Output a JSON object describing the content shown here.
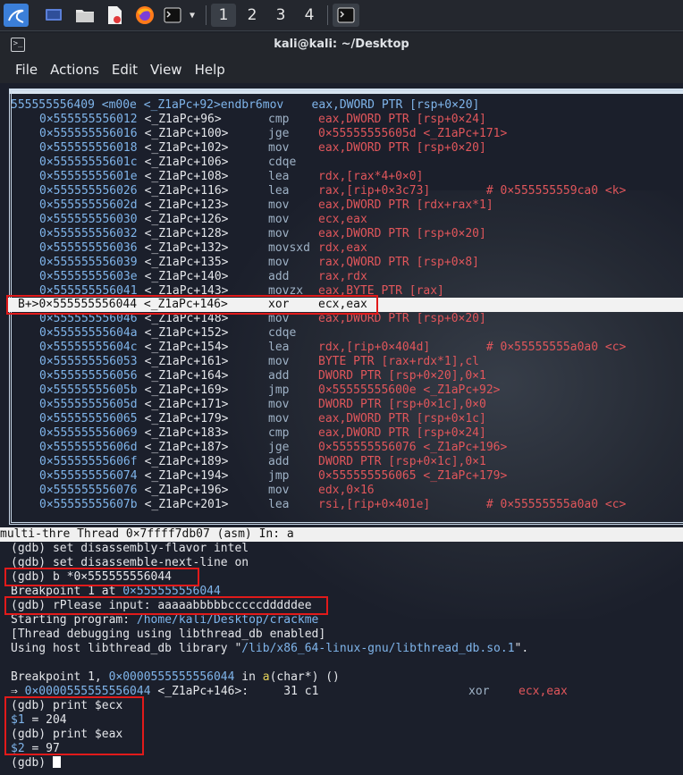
{
  "taskbar": {
    "workspaces": [
      "1",
      "2",
      "3",
      "4"
    ],
    "icons": [
      "kali-logo-icon",
      "workspace-icon",
      "files-icon",
      "editor-icon",
      "firefox-icon",
      "terminal-icon",
      "chevron-down-icon"
    ]
  },
  "window": {
    "title": "kali@kali: ~/Desktop",
    "menu": [
      "File",
      "Actions",
      "Edit",
      "View",
      "Help"
    ]
  },
  "asm": {
    "first_line": "555555556409 <m00e <_Z1aPc+92>endbr6mov    eax,DWORD PTR [rsp+0×20]",
    "rows": [
      {
        "addr": "0×555555556012",
        "sym": "<_Z1aPc+96>",
        "op": "cmp",
        "args": "eax,DWORD PTR [rsp+0×24]"
      },
      {
        "addr": "0×555555556016",
        "sym": "<_Z1aPc+100>",
        "op": "jge",
        "args": "0×55555555605d <_Z1aPc+171>"
      },
      {
        "addr": "0×555555556018",
        "sym": "<_Z1aPc+102>",
        "op": "mov",
        "args": "eax,DWORD PTR [rsp+0×20]"
      },
      {
        "addr": "0×55555555601c",
        "sym": "<_Z1aPc+106>",
        "op": "cdqe",
        "args": ""
      },
      {
        "addr": "0×55555555601e",
        "sym": "<_Z1aPc+108>",
        "op": "lea",
        "args": "rdx,[rax*4+0×0]"
      },
      {
        "addr": "0×555555556026",
        "sym": "<_Z1aPc+116>",
        "op": "lea",
        "args": "rax,[rip+0×3c73]        # 0×555555559ca0 <k>"
      },
      {
        "addr": "0×55555555602d",
        "sym": "<_Z1aPc+123>",
        "op": "mov",
        "args": "eax,DWORD PTR [rdx+rax*1]"
      },
      {
        "addr": "0×555555556030",
        "sym": "<_Z1aPc+126>",
        "op": "mov",
        "args": "ecx,eax"
      },
      {
        "addr": "0×555555556032",
        "sym": "<_Z1aPc+128>",
        "op": "mov",
        "args": "eax,DWORD PTR [rsp+0×20]"
      },
      {
        "addr": "0×555555556036",
        "sym": "<_Z1aPc+132>",
        "op": "movsxd",
        "args": "rdx,eax"
      },
      {
        "addr": "0×555555556039",
        "sym": "<_Z1aPc+135>",
        "op": "mov",
        "args": "rax,QWORD PTR [rsp+0×8]"
      },
      {
        "addr": "0×55555555603e",
        "sym": "<_Z1aPc+140>",
        "op": "add",
        "args": "rax,rdx"
      },
      {
        "addr": "0×555555556041",
        "sym": "<_Z1aPc+143>",
        "op": "movzx",
        "args": "eax,BYTE PTR [rax]"
      }
    ],
    "current": {
      "marker": "B+>",
      "addr": "0×555555556044",
      "sym": "<_Z1aPc+146>",
      "op": "xor",
      "args": "ecx,eax"
    },
    "rows_after": [
      {
        "addr": "0×555555556046",
        "sym": "<_Z1aPc+148>",
        "op": "mov",
        "args": "eax,DWORD PTR [rsp+0×20]"
      },
      {
        "addr": "0×55555555604a",
        "sym": "<_Z1aPc+152>",
        "op": "cdqe",
        "args": ""
      },
      {
        "addr": "0×55555555604c",
        "sym": "<_Z1aPc+154>",
        "op": "lea",
        "args": "rdx,[rip+0×404d]        # 0×55555555a0a0 <c>"
      },
      {
        "addr": "0×555555556053",
        "sym": "<_Z1aPc+161>",
        "op": "mov",
        "args": "BYTE PTR [rax+rdx*1],cl"
      },
      {
        "addr": "0×555555556056",
        "sym": "<_Z1aPc+164>",
        "op": "add",
        "args": "DWORD PTR [rsp+0×20],0×1"
      },
      {
        "addr": "0×55555555605b",
        "sym": "<_Z1aPc+169>",
        "op": "jmp",
        "args": "0×55555555600e <_Z1aPc+92>"
      },
      {
        "addr": "0×55555555605d",
        "sym": "<_Z1aPc+171>",
        "op": "mov",
        "args": "DWORD PTR [rsp+0×1c],0×0"
      },
      {
        "addr": "0×555555556065",
        "sym": "<_Z1aPc+179>",
        "op": "mov",
        "args": "eax,DWORD PTR [rsp+0×1c]"
      },
      {
        "addr": "0×555555556069",
        "sym": "<_Z1aPc+183>",
        "op": "cmp",
        "args": "eax,DWORD PTR [rsp+0×24]"
      },
      {
        "addr": "0×55555555606d",
        "sym": "<_Z1aPc+187>",
        "op": "jge",
        "args": "0×555555556076 <_Z1aPc+196>"
      },
      {
        "addr": "0×55555555606f",
        "sym": "<_Z1aPc+189>",
        "op": "add",
        "args": "DWORD PTR [rsp+0×1c],0×1"
      },
      {
        "addr": "0×555555556074",
        "sym": "<_Z1aPc+194>",
        "op": "jmp",
        "args": "0×555555556065 <_Z1aPc+179>"
      },
      {
        "addr": "0×555555556076",
        "sym": "<_Z1aPc+196>",
        "op": "mov",
        "args": "edx,0×16"
      },
      {
        "addr": "0×55555555607b",
        "sym": "<_Z1aPc+201>",
        "op": "lea",
        "args": "rsi,[rip+0×401e]        # 0×55555555a0a0 <c>"
      }
    ]
  },
  "status_line": "multi-thre Thread 0×7ffff7db07 (asm) In: a",
  "gdb": {
    "l1": "(gdb) set disassembly-flavor intel",
    "l2": "(gdb) set disassemble-next-line on",
    "l3": "(gdb) b *0×555555556044",
    "l4a": "Breakpoint 1 at ",
    "l4b": "0×555555556044",
    "l5": "(gdb) rPlease input: aaaaabbbbbcccccdddddee",
    "l6a": "Starting program: ",
    "l6b": "/home/kali/Desktop/crackme",
    "l7": "[Thread debugging using libthread_db enabled]",
    "l8a": "Using host libthread_db library \"",
    "l8b": "/lib/x86_64-linux-gnu/libthread_db.so.1",
    "l8c": "\".",
    "l9a": "Breakpoint 1, ",
    "l9b": "0×0000555555556044",
    "l9c": " in ",
    "l9d": "a",
    "l9e": "(char*) ()",
    "l10a": "⇒ ",
    "l10b": "0×0000555555556044",
    "l10c": " <_Z1aPc+146>:",
    "l10d": "     31 c1",
    "l10e": "xor",
    "l10f": "ecx,eax",
    "l11": "(gdb) print $ecx",
    "l12a": "$1",
    "l12b": " = 204",
    "l13": "(gdb) print $eax",
    "l14a": "$2",
    "l14b": " = 97",
    "l15": "(gdb) "
  }
}
